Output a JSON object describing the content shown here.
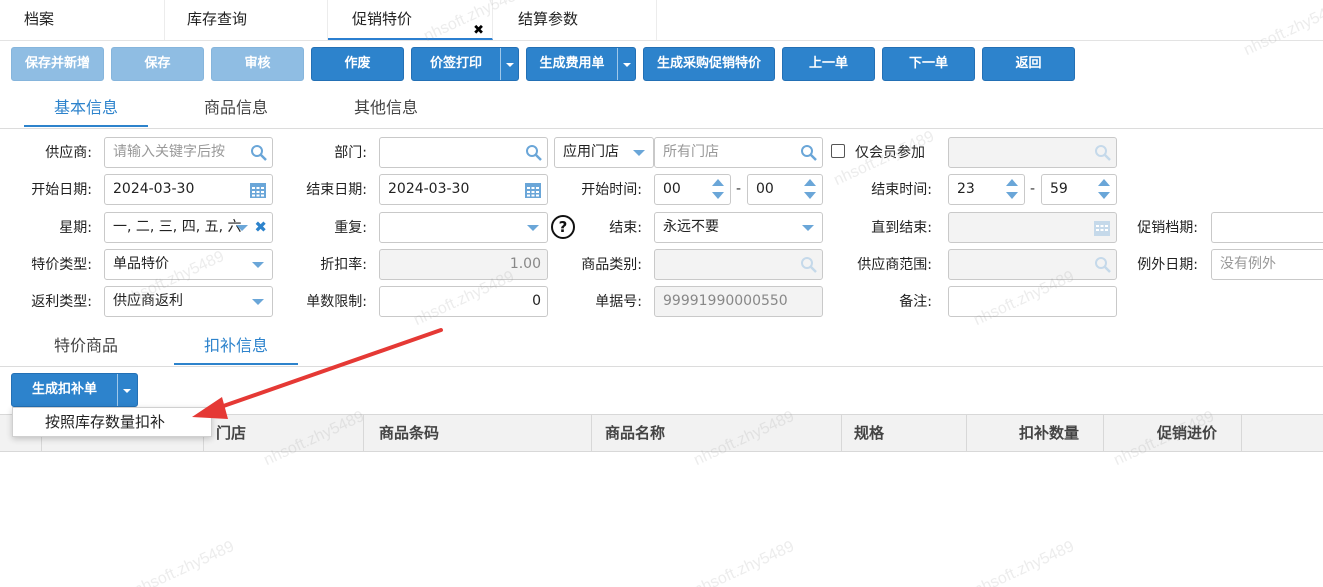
{
  "top_tabs": [
    "档案",
    "库存查询",
    "促销特价",
    "结算参数"
  ],
  "toolbar": {
    "save_new": "保存并新增",
    "save": "保存",
    "audit": "审核",
    "void": "作废",
    "price_tag_print": "价签打印",
    "gen_expense": "生成费用单",
    "gen_purchase_promo": "生成采购促销特价",
    "prev": "上一单",
    "next": "下一单",
    "back": "返回"
  },
  "form_tabs": [
    "基本信息",
    "商品信息",
    "其他信息"
  ],
  "form": {
    "supplier": {
      "label": "供应商:",
      "placeholder": "请输入关键字后按"
    },
    "dept": {
      "label": "部门:",
      "value": ""
    },
    "apply_store_select": "应用门店",
    "all_stores": "所有门店",
    "member_only": "仅会员参加",
    "start_date": {
      "label": "开始日期:",
      "value": "2024-03-30"
    },
    "end_date": {
      "label": "结束日期:",
      "value": "2024-03-30"
    },
    "start_time": {
      "label": "开始时间:",
      "hour": "00",
      "minute": "00"
    },
    "end_time": {
      "label": "结束时间:",
      "hour": "23",
      "minute": "59"
    },
    "weekday": {
      "label": "星期:",
      "value": "一, 二, 三, 四, 五, 六"
    },
    "repeat": {
      "label": "重复:",
      "value": ""
    },
    "end": {
      "label": "结束:",
      "value": "永远不要"
    },
    "until_end": {
      "label": "直到结束:"
    },
    "promo_level": {
      "label": "促销档期:"
    },
    "price_type": {
      "label": "特价类型:",
      "value": "单品特价"
    },
    "discount": {
      "label": "折扣率:",
      "value": "1.00"
    },
    "category": {
      "label": "商品类别:"
    },
    "supplier_range": {
      "label": "供应商范围:"
    },
    "exception_date": {
      "label": "例外日期:",
      "placeholder": "没有例外"
    },
    "rebate_type": {
      "label": "返利类型:",
      "value": "供应商返利"
    },
    "qty_limit": {
      "label": "单数限制:",
      "value": "0"
    },
    "doc_no": {
      "label": "单据号:",
      "value": "99991990000550"
    },
    "remark": {
      "label": "备注:"
    }
  },
  "detail_tabs": [
    "特价商品",
    "扣补信息"
  ],
  "gen_button": "生成扣补单",
  "menu_item": "按照库存数量扣补",
  "grid_headers": [
    "门店",
    "商品条码",
    "商品名称",
    "规格",
    "扣补数量",
    "促销进价"
  ],
  "watermark": "nhsoft.zhy5489",
  "colors": {
    "primary": "#2d83cc",
    "arrow": "#e53935"
  }
}
